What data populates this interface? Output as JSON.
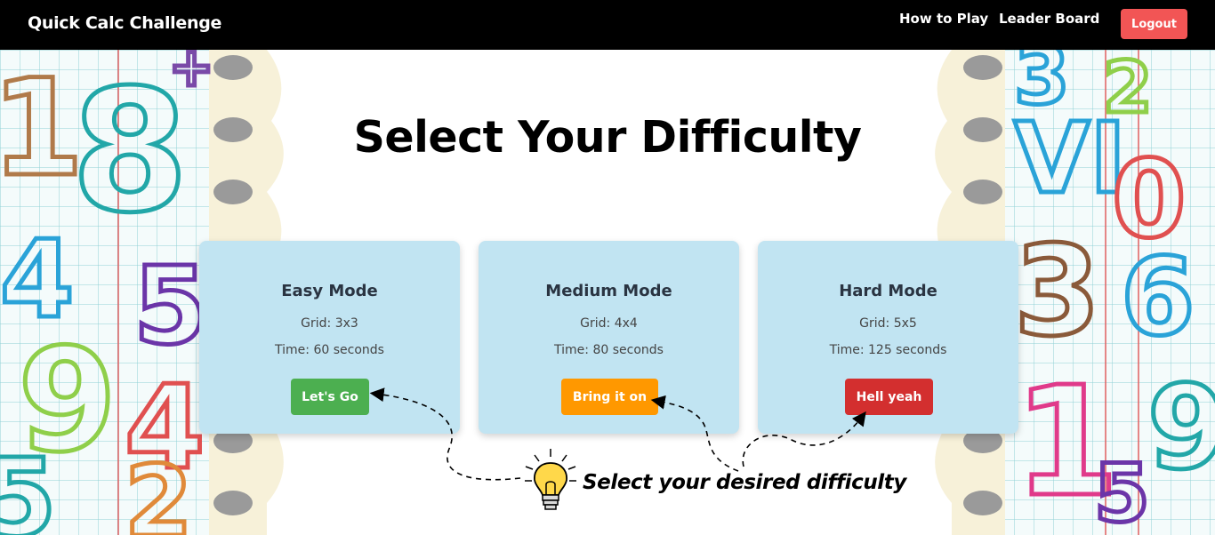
{
  "app": {
    "brand": "Quick Calc Challenge"
  },
  "nav": {
    "how_to_play": "How to Play",
    "leader_board": "Leader Board",
    "logout": "Logout"
  },
  "main": {
    "title": "Select Your Difficulty",
    "hint": "Select your desired difficulty"
  },
  "cards": [
    {
      "title": "Easy Mode",
      "grid": "Grid: 3x3",
      "time": "Time: 60 seconds",
      "button": "Let's Go",
      "color": "#4caf50"
    },
    {
      "title": "Medium Mode",
      "grid": "Grid: 4x4",
      "time": "Time: 80 seconds",
      "button": "Bring it on",
      "color": "#ff9800"
    },
    {
      "title": "Hard Mode",
      "grid": "Grid: 5x5",
      "time": "Time: 125 seconds",
      "button": "Hell yeah",
      "color": "#d32f2f"
    }
  ],
  "colors": {
    "navbar": "#000000",
    "logout": "#f25555",
    "card_bg": "#c1e4f2"
  },
  "icons": [
    "lightbulb-icon",
    "dashed-arrow-icon"
  ]
}
